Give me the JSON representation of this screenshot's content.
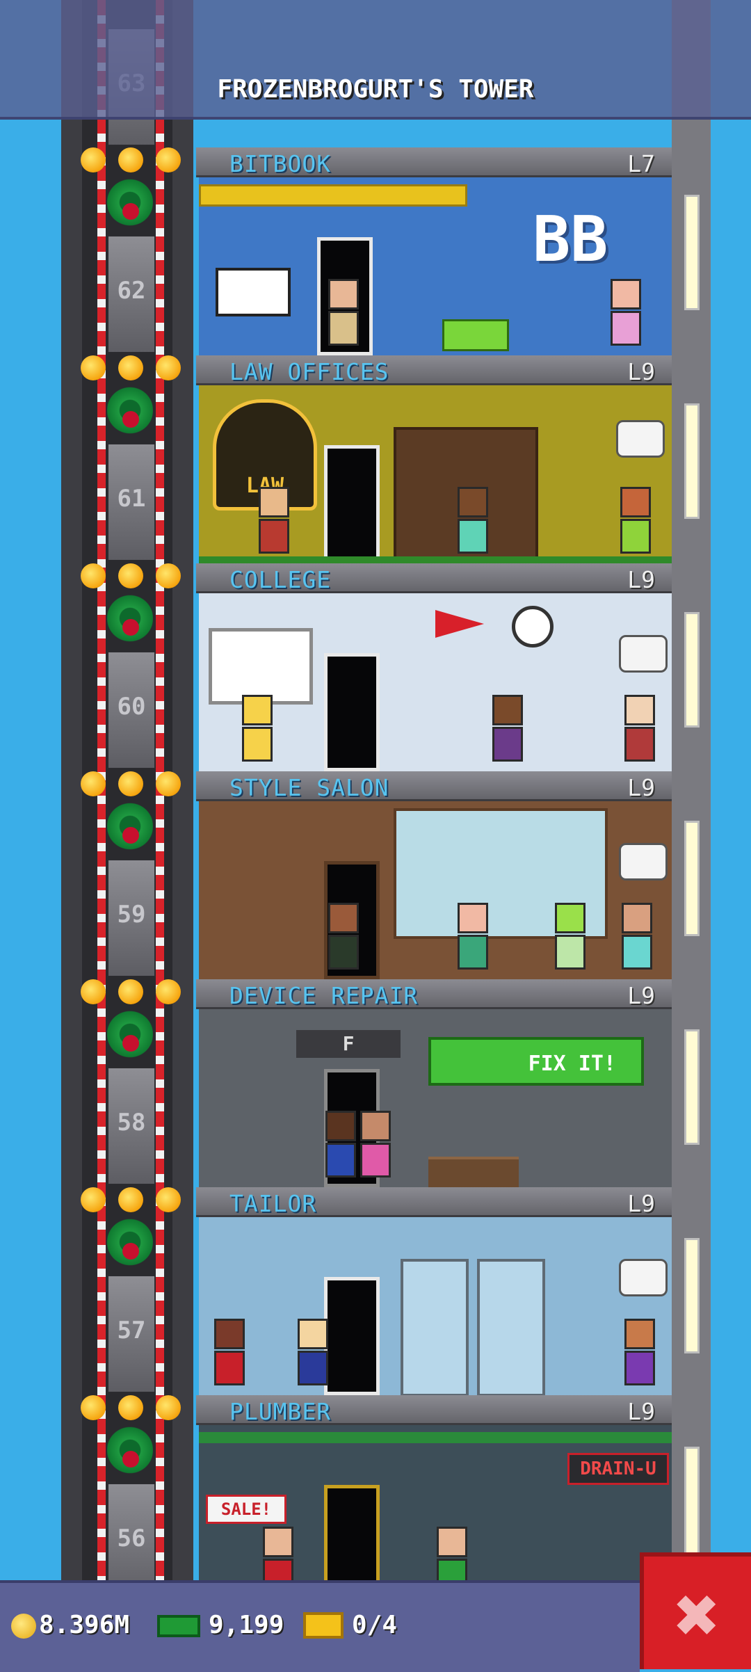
{
  "tower": {
    "title": "FROZENBROGURT'S TOWER"
  },
  "floors": [
    {
      "name": "BITBOOK",
      "level": "L7",
      "elevator_number": "62",
      "room_color": "#3f78c6",
      "header_accent": "#58c4f0"
    },
    {
      "name": "LAW OFFICES",
      "level": "L9",
      "elevator_number": "61",
      "room_color": "#a89b22",
      "header_accent": "#58c4f0"
    },
    {
      "name": "COLLEGE",
      "level": "L9",
      "elevator_number": "60",
      "room_color": "#d7e2ee",
      "header_accent": "#58c4f0"
    },
    {
      "name": "STYLE SALON",
      "level": "L9",
      "elevator_number": "59",
      "room_color": "#7a5236",
      "header_accent": "#58c4f0"
    },
    {
      "name": "DEVICE REPAIR",
      "level": "L9",
      "elevator_number": "58",
      "room_color": "#5d6268",
      "header_accent": "#58c4f0"
    },
    {
      "name": "TAILOR",
      "level": "L9",
      "elevator_number": "57",
      "room_color": "#8db8d6",
      "header_accent": "#58c4f0"
    },
    {
      "name": "PLUMBER",
      "level": "L9",
      "elevator_number": "56",
      "room_color": "#3d4e58",
      "header_accent": "#58c4f0"
    }
  ],
  "top_elevator_number": "63",
  "signs": {
    "bitbook_logo": "BB",
    "law_sign": "LAW",
    "repair_sign": "FIX IT!",
    "repair_letter": "F",
    "sale_sign": "SALE!",
    "drain_sign": "DRAIN-U"
  },
  "status_bar": {
    "coins": "8.396M",
    "bux": "9,199",
    "tickets": "0/4"
  },
  "close_label": "✖",
  "colors": {
    "sky": "#3aaee8",
    "banner": "#5a6092",
    "close": "#d81f26"
  }
}
